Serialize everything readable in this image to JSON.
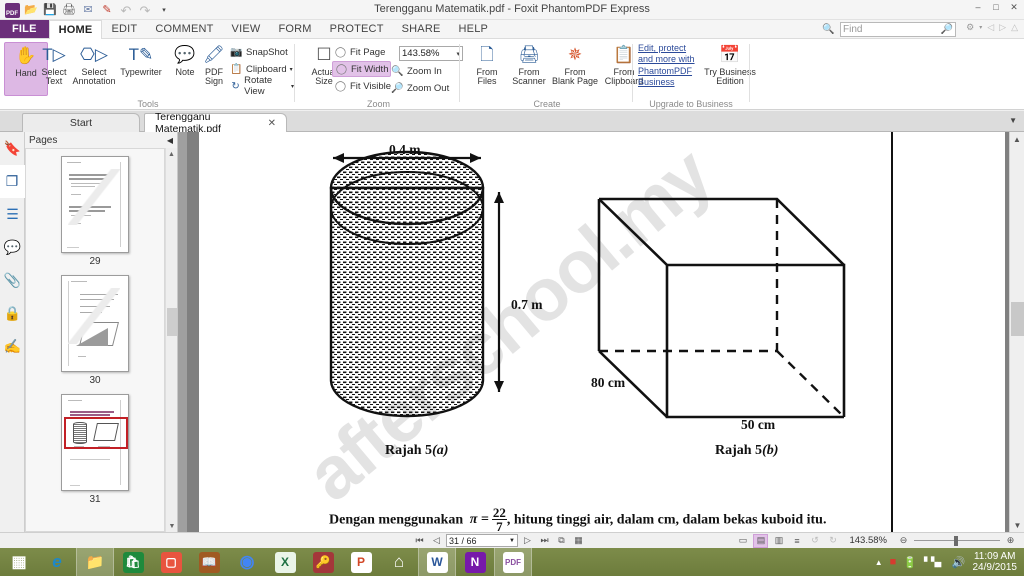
{
  "window": {
    "title": "Terengganu Matematik.pdf - Foxit PhantomPDF Express",
    "quick_access": [
      {
        "name": "app-logo",
        "glyph": "PDF"
      },
      {
        "name": "open-icon",
        "glyph": "📂"
      },
      {
        "name": "save-icon",
        "glyph": "💾"
      },
      {
        "name": "print-icon",
        "glyph": "🖨"
      },
      {
        "name": "email-icon",
        "glyph": "✉"
      },
      {
        "name": "highlight-icon",
        "glyph": "✎"
      },
      {
        "name": "undo-icon",
        "glyph": "↶"
      },
      {
        "name": "redo-icon",
        "glyph": "↷"
      },
      {
        "name": "customize-icon",
        "glyph": "▾"
      }
    ],
    "controls": {
      "minimize": "–",
      "maximize": "□",
      "close": "✕"
    }
  },
  "ribbon_tabs": [
    {
      "label": "FILE",
      "kind": "file"
    },
    {
      "label": "HOME",
      "kind": "active"
    },
    {
      "label": "EDIT",
      "kind": "normal"
    },
    {
      "label": "COMMENT",
      "kind": "normal"
    },
    {
      "label": "VIEW",
      "kind": "normal"
    },
    {
      "label": "FORM",
      "kind": "normal"
    },
    {
      "label": "PROTECT",
      "kind": "normal"
    },
    {
      "label": "SHARE",
      "kind": "normal"
    },
    {
      "label": "HELP",
      "kind": "normal"
    }
  ],
  "search": {
    "placeholder": "Find",
    "icon": "search-icon"
  },
  "ribbon": {
    "groups": [
      {
        "label": "Tools"
      },
      {
        "label": "Zoom"
      },
      {
        "label": "Create"
      },
      {
        "label": "Upgrade to Business"
      }
    ],
    "tools": {
      "hand": "Hand",
      "select_text_l1": "Select",
      "select_text_l2": "Text",
      "select_annotation_l1": "Select",
      "select_annotation_l2": "Annotation",
      "typewriter": "Typewriter",
      "note": "Note",
      "pdf_sign_l1": "PDF",
      "pdf_sign_l2": "Sign",
      "snapshot": "SnapShot",
      "clipboard": "Clipboard",
      "rotate_view": "Rotate View"
    },
    "zoom": {
      "actual_size_l1": "Actual",
      "actual_size_l2": "Size",
      "fit_page": "Fit Page",
      "fit_width": "Fit Width",
      "fit_visible": "Fit Visible",
      "zoom_in": "Zoom In",
      "zoom_out": "Zoom Out",
      "level": "143.58%"
    },
    "create": {
      "from_files_l1": "From",
      "from_files_l2": "Files",
      "from_scanner_l1": "From",
      "from_scanner_l2": "Scanner",
      "from_blank_l1": "From",
      "from_blank_l2": "Blank Page",
      "from_clipboard_l1": "From",
      "from_clipboard_l2": "Clipboard"
    },
    "upgrade": {
      "link": "Edit, protect and more with PhantomPDF Business",
      "try_l1": "Try Business",
      "try_l2": "Edition"
    }
  },
  "doc_tabs": [
    {
      "label": "Start",
      "active": false,
      "closable": false
    },
    {
      "label": "Terengganu Matematik.pdf",
      "active": true,
      "closable": true,
      "close_glyph": "✕"
    }
  ],
  "nav_rail": [
    {
      "name": "bookmarks-icon",
      "glyph": "🔖",
      "color": "#7a3b9e",
      "active": false
    },
    {
      "name": "pages-icon",
      "glyph": "❐",
      "color": "#2b5c96",
      "active": true
    },
    {
      "name": "layers-icon",
      "glyph": "☲",
      "color": "#2b6fb5",
      "active": false
    },
    {
      "name": "comments-icon",
      "glyph": "💬",
      "color": "#e0a526",
      "active": false
    },
    {
      "name": "attachments-icon",
      "glyph": "📎",
      "color": "#3f7fbf",
      "active": false
    },
    {
      "name": "security-icon",
      "glyph": "🔒",
      "color": "#e0a526",
      "active": false
    },
    {
      "name": "signatures-icon",
      "glyph": "✍",
      "color": "#3a5fa8",
      "active": false
    }
  ],
  "pages_panel": {
    "title": "Pages",
    "collapse_glyph": "◀",
    "thumbnails": [
      {
        "page": "29",
        "selected": false
      },
      {
        "page": "30",
        "selected": false
      },
      {
        "page": "31",
        "selected": true
      }
    ]
  },
  "document": {
    "watermark": "afterschool.my",
    "figure_a": {
      "caption_main": "Rajah 5",
      "caption_label": "(a)",
      "width_label": "0.4 m",
      "height_label": "0.7 m"
    },
    "figure_b": {
      "caption_main": "Rajah 5",
      "caption_label": "(b)",
      "depth_label": "80 cm",
      "width_label": "50 cm"
    },
    "question": {
      "before": "Dengan menggunakan",
      "pi_symbol": "π =",
      "fraction_numerator": "22",
      "fraction_denominator": "7",
      "after": ", hitung tinggi air, dalam cm, dalam bekas kuboid itu."
    }
  },
  "statusbar": {
    "first_page_glyph": "⏮",
    "prev_page_glyph": "◁",
    "page_value": "31 / 66",
    "next_page_glyph": "▷",
    "last_page_glyph": "⏭",
    "fit_page_glyph": "⧉",
    "fit_width_glyph": "▦",
    "view_modes": [
      {
        "name": "single-page-view",
        "glyph": "▭",
        "selected": false
      },
      {
        "name": "continuous-view",
        "glyph": "▤",
        "selected": true
      },
      {
        "name": "facing-view",
        "glyph": "▥",
        "selected": false
      },
      {
        "name": "split-view",
        "glyph": "≡",
        "selected": false
      },
      {
        "name": "rotate-left",
        "glyph": "↺",
        "selected": false
      },
      {
        "name": "rotate-right",
        "glyph": "↻",
        "selected": false
      }
    ],
    "zoom_value": "143.58%",
    "zoom_out_glyph": "⊖",
    "zoom_in_glyph": "⊕"
  },
  "taskbar": {
    "items": [
      {
        "name": "start-button",
        "glyph": "⊞",
        "bg": "transparent",
        "fg": "#ffffff",
        "open": false
      },
      {
        "name": "internet-explorer-icon",
        "glyph": "e",
        "bg": "transparent",
        "fg": "#1e88c7",
        "open": false
      },
      {
        "name": "file-explorer-icon",
        "glyph": "📁",
        "bg": "transparent",
        "fg": "#e8bb55",
        "open": true
      },
      {
        "name": "store-icon",
        "glyph": "🛍",
        "bg": "#1e8a3c",
        "fg": "#ffffff",
        "open": false
      },
      {
        "name": "photos-icon",
        "glyph": "🖼",
        "bg": "#e8543f",
        "fg": "#ffffff",
        "open": false
      },
      {
        "name": "reader-icon",
        "glyph": "📖",
        "bg": "#a05a22",
        "fg": "#ffffff",
        "open": false
      },
      {
        "name": "chrome-icon",
        "glyph": "◉",
        "bg": "transparent",
        "fg": "#4285f4",
        "open": false
      },
      {
        "name": "excel-icon",
        "glyph": "X",
        "bg": "#dfeede",
        "fg": "#1d6f42",
        "open": false
      },
      {
        "name": "access-icon",
        "glyph": "🔑",
        "bg": "#a4373a",
        "fg": "#ffffff",
        "open": false
      },
      {
        "name": "powerpoint-icon",
        "glyph": "P",
        "bg": "#ffffff",
        "fg": "#d24726",
        "open": false
      },
      {
        "name": "home-icon",
        "glyph": "⌂",
        "bg": "transparent",
        "fg": "#ffffff",
        "open": false
      },
      {
        "name": "word-icon",
        "glyph": "W",
        "bg": "#ffffff",
        "fg": "#2b579a",
        "open": true
      },
      {
        "name": "onenote-icon",
        "glyph": "N",
        "bg": "#7719aa",
        "fg": "#ffffff",
        "open": false
      },
      {
        "name": "foxit-pdf-icon",
        "glyph": "PDF",
        "bg": "#ffffff",
        "fg": "#8a4fa0",
        "open": true
      }
    ],
    "tray": [
      {
        "name": "show-hidden-icons",
        "glyph": "▲"
      },
      {
        "name": "antivirus-icon",
        "glyph": "■"
      },
      {
        "name": "battery-icon",
        "glyph": "🔋"
      },
      {
        "name": "network-icon",
        "glyph": "▂▄▆"
      },
      {
        "name": "volume-icon",
        "glyph": "🔊"
      }
    ],
    "clock": {
      "time": "11:09 AM",
      "date": "24/9/2015"
    }
  }
}
